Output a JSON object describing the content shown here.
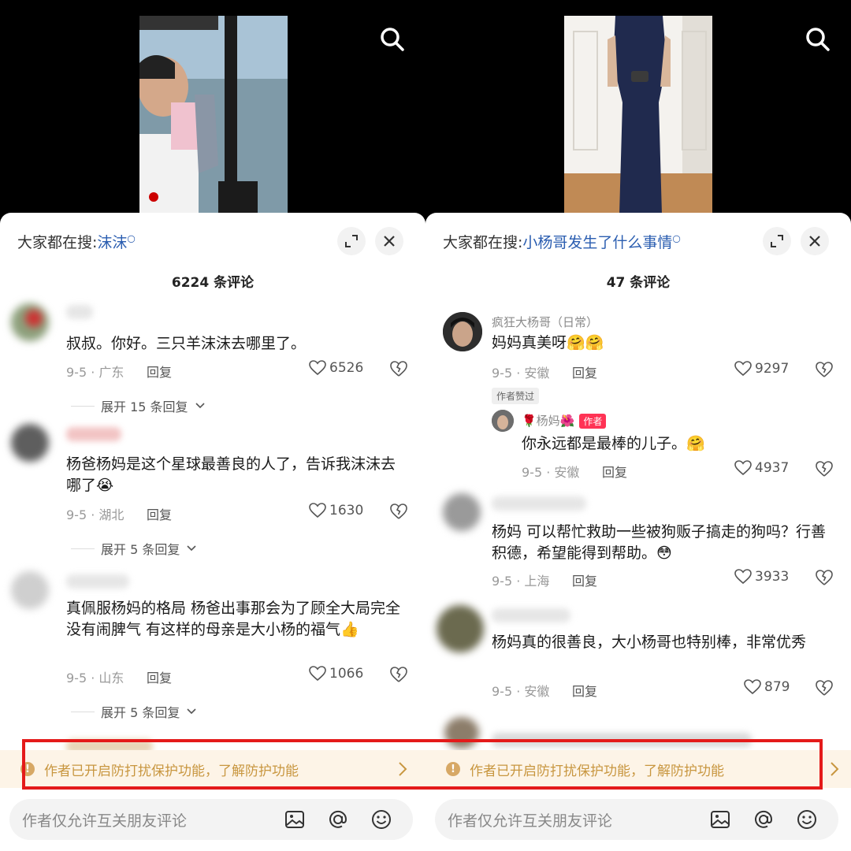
{
  "left": {
    "hot_label": "大家都在搜:",
    "hot_term": "沫沫",
    "count": "6224 条评论",
    "comments": [
      {
        "text": "叔叔。你好。三只羊沫沫去哪里了。",
        "meta": "9-5 · 广东",
        "reply": "回复",
        "likes": "6526",
        "expand": "展开 15 条回复"
      },
      {
        "text": "杨爸杨妈是这个星球最善良的人了，告诉我沫沫去哪了😭",
        "meta": "9-5 · 湖北",
        "reply": "回复",
        "likes": "1630",
        "expand": "展开 5 条回复"
      },
      {
        "text": "真佩服杨妈的格局 杨爸出事那会为了顾全大局完全没有闹脾气 有这样的母亲是大小杨的福气👍",
        "meta": "9-5 · 山东",
        "reply": "回复",
        "likes": "1066",
        "expand": "展开 5 条回复"
      }
    ],
    "notice": "作者已开启防打扰保护功能，了解防护功能",
    "input_placeholder": "作者仅允许互关朋友评论"
  },
  "right": {
    "hot_label": "大家都在搜:",
    "hot_term": "小杨哥发生了什么事情",
    "count": "47 条评论",
    "comments": [
      {
        "user": "疯狂大杨哥（日常）",
        "text": "妈妈真美呀🤗🤗",
        "meta": "9-5 · 安徽",
        "reply": "回复",
        "likes": "9297",
        "tag": "作者赞过"
      },
      {
        "user": "🌹杨妈🌺",
        "author_tag": "作者",
        "text": "你永远都是最棒的儿子。🤗",
        "meta": "9-5 · 安徽",
        "reply": "回复",
        "likes": "4937"
      },
      {
        "text": "杨妈 可以帮忙救助一些被狗贩子搞走的狗吗？行善积德，希望能得到帮助。😳",
        "meta": "9-5 · 上海",
        "reply": "回复",
        "likes": "3933"
      },
      {
        "text": "杨妈真的很善良，大小杨哥也特别棒，非常优秀",
        "meta": "9-5 · 安徽",
        "reply": "回复",
        "likes": "879"
      }
    ],
    "notice": "作者已开启防打扰保护功能，了解防护功能",
    "input_placeholder": "作者仅允许互关朋友评论"
  },
  "icons": {
    "search": "search-icon",
    "expand": "fullscreen-icon",
    "close": "close-icon",
    "like": "heart-icon",
    "dislike": "broken-heart-icon",
    "image": "image-icon",
    "mention": "at-icon",
    "emoji": "smiley-icon",
    "info": "info-icon",
    "chevron": "chevron-right-icon"
  },
  "colors": {
    "highlight_box": "#e41a1a",
    "hot_term": "#2a5db0",
    "notice_text": "#c8963f",
    "author_tag": "#ff3355"
  }
}
